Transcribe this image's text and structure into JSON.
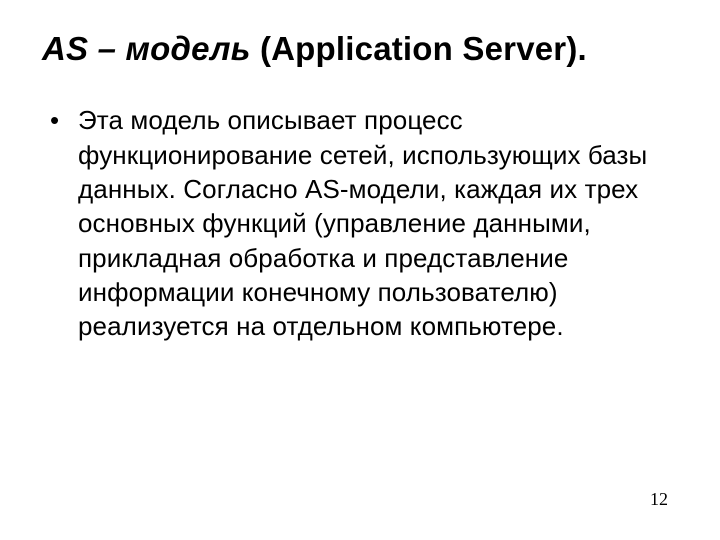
{
  "title": {
    "emphasis": "AS – модель",
    "rest": "  (Application Server)."
  },
  "body": {
    "text": "Эта модель описывает процесс функционирование сетей, использующих базы данных. Согласно AS-модели, каждая их трех основных функций (управление данными, прикладная обработка и представление информации конечному пользователю) реализуется на отдельном компьютере."
  },
  "page_number": "12"
}
